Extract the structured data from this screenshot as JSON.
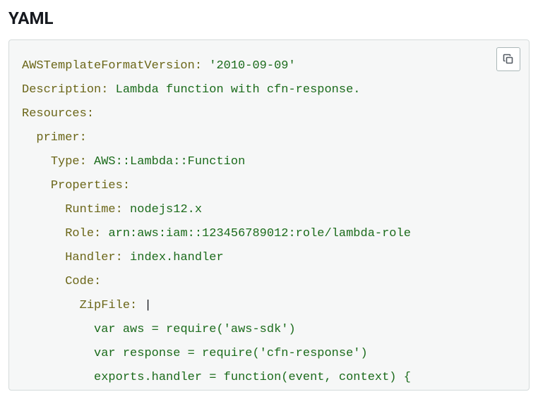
{
  "heading": "YAML",
  "copy_button_label": "Copy",
  "yaml": {
    "AWSTemplateFormatVersion": "'2010-09-09'",
    "Description": "Lambda function with cfn-response.",
    "Resources": {
      "primer": {
        "Type": "AWS::Lambda::Function",
        "Properties": {
          "Runtime": "nodejs12.x",
          "Role": "arn:aws:iam::123456789012:role/lambda-role",
          "Handler": "index.handler",
          "Code": {
            "ZipFile_literal": "|",
            "ZipFile_lines": [
              "var aws = require('aws-sdk')",
              "var response = require('cfn-response')",
              "exports.handler = function(event, context) {"
            ]
          }
        }
      }
    }
  },
  "labels": {
    "AWSTemplateFormatVersion": "AWSTemplateFormatVersion:",
    "Description": "Description:",
    "Resources": "Resources:",
    "primer": "primer:",
    "Type": "Type:",
    "Properties": "Properties:",
    "Runtime": "Runtime:",
    "Role": "Role:",
    "Handler": "Handler:",
    "Code": "Code:",
    "ZipFile": "ZipFile:"
  }
}
